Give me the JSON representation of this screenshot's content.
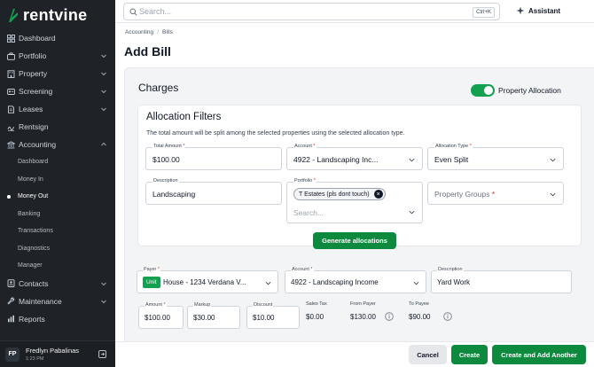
{
  "brand": {
    "name": "rentvine",
    "accent": "#12a150",
    "accent_dark": "#0d8a3e"
  },
  "sidebar": {
    "items": [
      {
        "label": "Dashboard",
        "icon": "dashboard-icon"
      },
      {
        "label": "Portfolio",
        "icon": "briefcase-icon",
        "chevron": "chevron-down-icon"
      },
      {
        "label": "Property",
        "icon": "building-icon",
        "chevron": "chevron-down-icon"
      },
      {
        "label": "Screening",
        "icon": "screening-icon",
        "chevron": "chevron-down-icon"
      },
      {
        "label": "Leases",
        "icon": "lease-icon",
        "chevron": "chevron-down-icon"
      },
      {
        "label": "Rentsign",
        "icon": "signature-icon"
      },
      {
        "label": "Accounting",
        "icon": "bank-icon",
        "chevron": "chevron-up-icon"
      }
    ],
    "accounting_sub": [
      {
        "label": "Dashboard"
      },
      {
        "label": "Money In"
      },
      {
        "label": "Money Out",
        "active": true
      },
      {
        "label": "Banking"
      },
      {
        "label": "Transactions"
      },
      {
        "label": "Diagnostics"
      },
      {
        "label": "Manager"
      }
    ],
    "bottom_items": [
      {
        "label": "Contacts",
        "icon": "contacts-icon",
        "chevron": "chevron-down-icon"
      },
      {
        "label": "Maintenance",
        "icon": "wrench-icon",
        "chevron": "chevron-down-icon"
      },
      {
        "label": "Reports",
        "icon": "reports-icon"
      }
    ],
    "user": {
      "initials": "FP",
      "name": "Fredlyn Pabalinas",
      "time": "1:23 PM"
    }
  },
  "topbar": {
    "search_placeholder": "Search...",
    "shortcut": "Ctrl+K",
    "assistant_label": "Assistant"
  },
  "breadcrumb": {
    "parent": "Accounting",
    "separator": "/",
    "current": "Bills"
  },
  "page_title": "Add Bill",
  "charges": {
    "title": "Charges",
    "property_allocation_label": "Property Allocation",
    "property_allocation_on": true
  },
  "allocation_filters": {
    "title": "Allocation Filters",
    "description": "The total amount will be split among the selected properties using the selected allocation type.",
    "total_amount": {
      "label": "Total Amount",
      "value": "$100.00"
    },
    "account": {
      "label": "Account",
      "value": "4922 - Landscaping Inc..."
    },
    "allocation_type": {
      "label": "Allocation Type",
      "value": "Even Split"
    },
    "description_field": {
      "label": "Description",
      "value": "Landscaping"
    },
    "portfolio": {
      "label": "Portfolio",
      "chip": "T Estates (pls dont touch)",
      "placeholder": "Search..."
    },
    "property_groups": {
      "placeholder": "Property Groups"
    },
    "generate_button": "Generate allocations"
  },
  "bill_line": {
    "payer": {
      "label": "Payer",
      "badge": "Unit",
      "value": "House - 1234 Verdana V..."
    },
    "account": {
      "label": "Account",
      "value": "4922 - Landscaping Income"
    },
    "description": {
      "label": "Description",
      "value": "Yard Work"
    },
    "amount": {
      "label": "Amount",
      "value": "$100.00"
    },
    "markup": {
      "label": "Markup",
      "value": "$30.00"
    },
    "discount": {
      "label": "Discount",
      "value": "$10.00"
    },
    "sales_tax": {
      "label": "Sales Tax",
      "value": "$0.00"
    },
    "from_payer": {
      "label": "From Payer",
      "value": "$130.00"
    },
    "to_payee": {
      "label": "To Payee",
      "value": "$90.00"
    }
  },
  "footer": {
    "cancel": "Cancel",
    "create": "Create",
    "create_another": "Create and Add Another"
  }
}
